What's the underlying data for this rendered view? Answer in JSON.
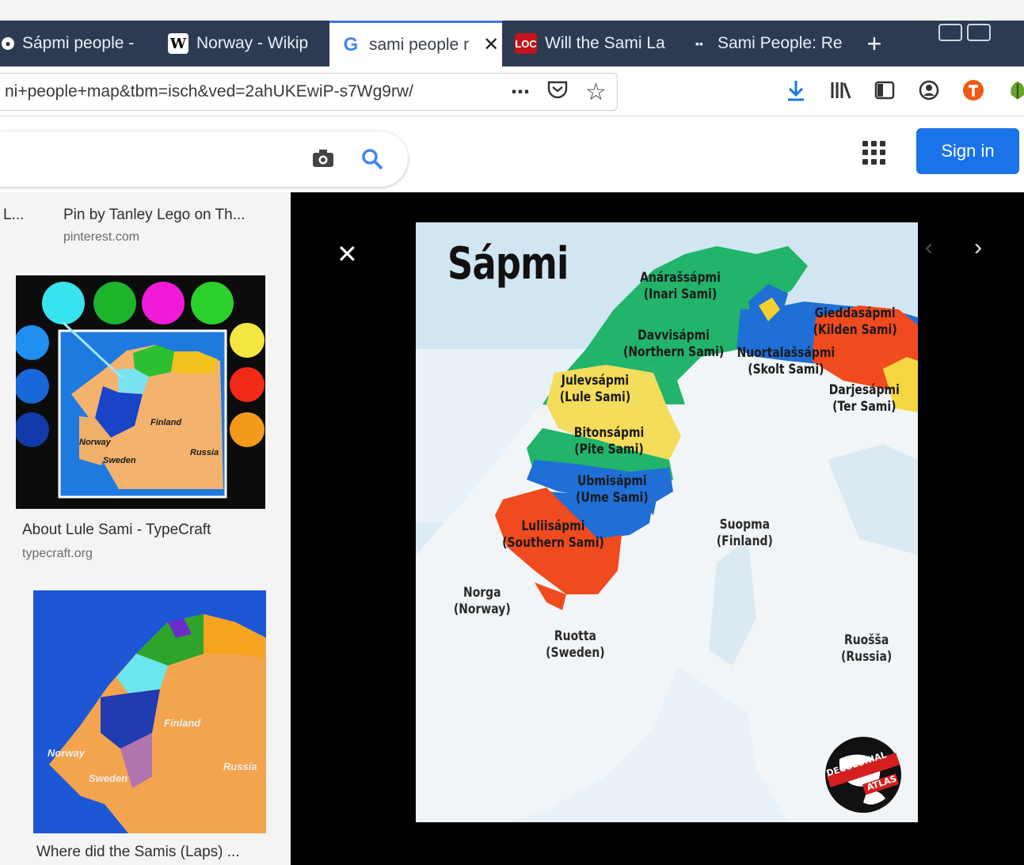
{
  "tabs": [
    {
      "label": "Sápmi people -",
      "icon": "globe-icon",
      "active": false
    },
    {
      "label": "Norway - Wikip",
      "icon": "wikipedia-icon",
      "active": false
    },
    {
      "label": "sami people r",
      "icon": "google-icon",
      "active": true
    },
    {
      "label": "Will the Sami La",
      "icon": "loc-icon",
      "active": false
    },
    {
      "label": "Sami People: Re",
      "icon": "site-icon",
      "active": false
    }
  ],
  "favicons": {
    "wikipedia": "W",
    "google": "G",
    "loc": "LOC",
    "site": "▪▪"
  },
  "url": "ni+people+map&tbm=isch&ved=2ahUKEwiP-s7Wg9rw/",
  "page_actions": {
    "more": "⋯",
    "pocket": "⬡",
    "bookmark": "☆"
  },
  "signin_label": "Sign in",
  "results": [
    {
      "title": "Pin by Tanley Lego on Th...",
      "source": "pinterest.com",
      "prefix": "L..."
    },
    {
      "title": "About Lule Sami - TypeCraft",
      "source": "typecraft.org"
    },
    {
      "title": "Where did the Samis (Laps) ..."
    }
  ],
  "thumb_labels": {
    "finland": "Finland",
    "norway": "Norway",
    "sweden": "Sweden",
    "russia": "Russia"
  },
  "preview": {
    "close": "✕",
    "prev": "‹",
    "next": "›",
    "map_title": "Sápmi",
    "regions": [
      {
        "name": "Anárašsápmi",
        "sub": "(Inari Sami)"
      },
      {
        "name": "Davvisápmi",
        "sub": "(Northern Sami)"
      },
      {
        "name": "Nuortalašsápmi",
        "sub": "(Skolt Sami)"
      },
      {
        "name": "Gieddasápmi",
        "sub": "(Kilden Sami)"
      },
      {
        "name": "Darjesápmi",
        "sub": "(Ter Sami)"
      },
      {
        "name": "Julevsápmi",
        "sub": "(Lule Sami)"
      },
      {
        "name": "Bitonsápmi",
        "sub": "(Pite Sami)"
      },
      {
        "name": "Ubmisápmi",
        "sub": "(Ume Sami)"
      },
      {
        "name": "Luliisápmi",
        "sub": "(Southern Sami)"
      }
    ],
    "countries": [
      {
        "name": "Suopma",
        "sub": "(Finland)"
      },
      {
        "name": "Norga",
        "sub": "(Norway)"
      },
      {
        "name": "Ruotta",
        "sub": "(Sweden)"
      },
      {
        "name": "Ruošša",
        "sub": "(Russia)"
      }
    ],
    "logo_text": [
      "DECOLONIAL",
      "ATLAS"
    ]
  },
  "colors": {
    "tabbar": "#2d3b52",
    "accent": "#1a73e8",
    "green": "#21b46a",
    "yellow": "#f3dd5a",
    "blue": "#1f6fd6",
    "red": "#f04a1f",
    "orange": "#f7a540"
  }
}
